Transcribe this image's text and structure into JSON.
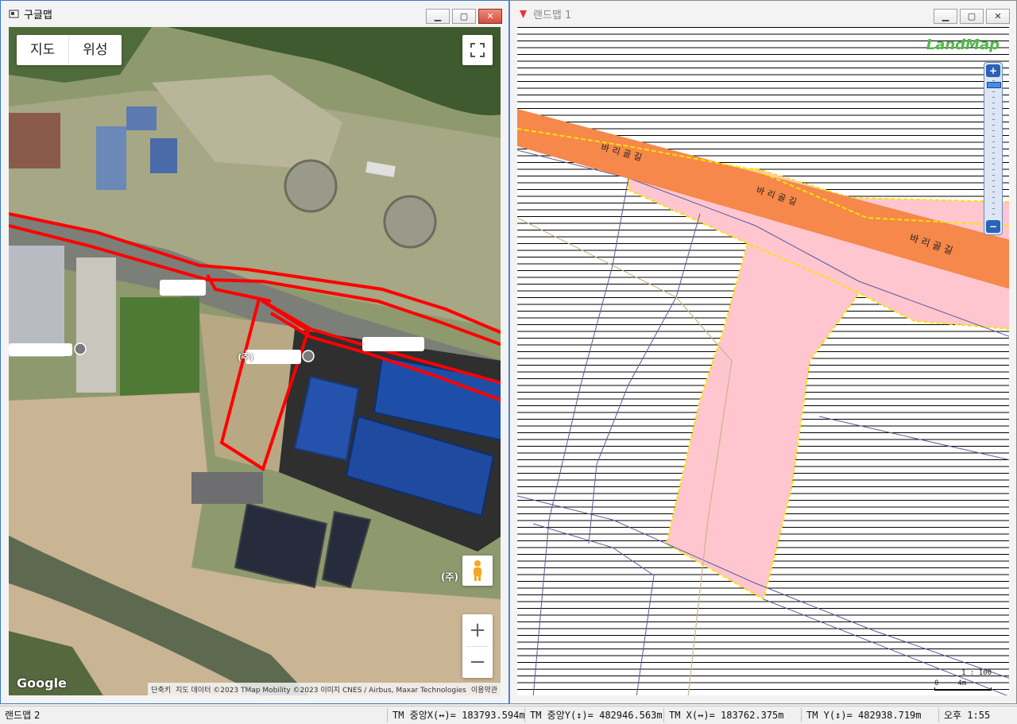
{
  "google_window": {
    "title": "구글맵",
    "map_type": {
      "map": "지도",
      "satellite": "위성"
    },
    "fullscreen_icon": "fullscreen-icon",
    "pegman_icon": "pegman-icon",
    "zoom_in": "+",
    "zoom_out": "−",
    "logo": "Google",
    "attribution": {
      "shortcuts": "단축키",
      "data": "지도 데이터 ©2023 TMap Mobility ©2023 이미지 CNES / Airbus, Maxar Technologies",
      "terms": "이용약관"
    },
    "labels": {
      "company_left": "(주)",
      "company_bottom": "(주)"
    },
    "colors": {
      "parcel_outline": "#ff0000"
    }
  },
  "landmap_window": {
    "title": "랜드맵 1",
    "logo": "LandMap",
    "road_labels": [
      "바리골길",
      "바리골길",
      "바리골길"
    ],
    "zoom_in": "+",
    "zoom_out": "−",
    "scale": {
      "ratio": "1 : 100",
      "start": "0",
      "end": "4m"
    },
    "colors": {
      "road": "#f5884a",
      "parcel_fill": "#ffc6d0",
      "boundary": "#f6e400",
      "hatch": "#000000",
      "parcel_lines": "#4a4a8a"
    }
  },
  "status_bar": {
    "app_title": "랜드맵 2",
    "tm_center_x": "TM 중앙X(↔)= 183793.594m",
    "tm_center_y": "TM 중앙Y(↕)= 482946.563m",
    "tm_x": "TM X(↔)= 183762.375m",
    "tm_y": "TM Y(↕)= 482938.719m",
    "time": "오후 1:55"
  }
}
